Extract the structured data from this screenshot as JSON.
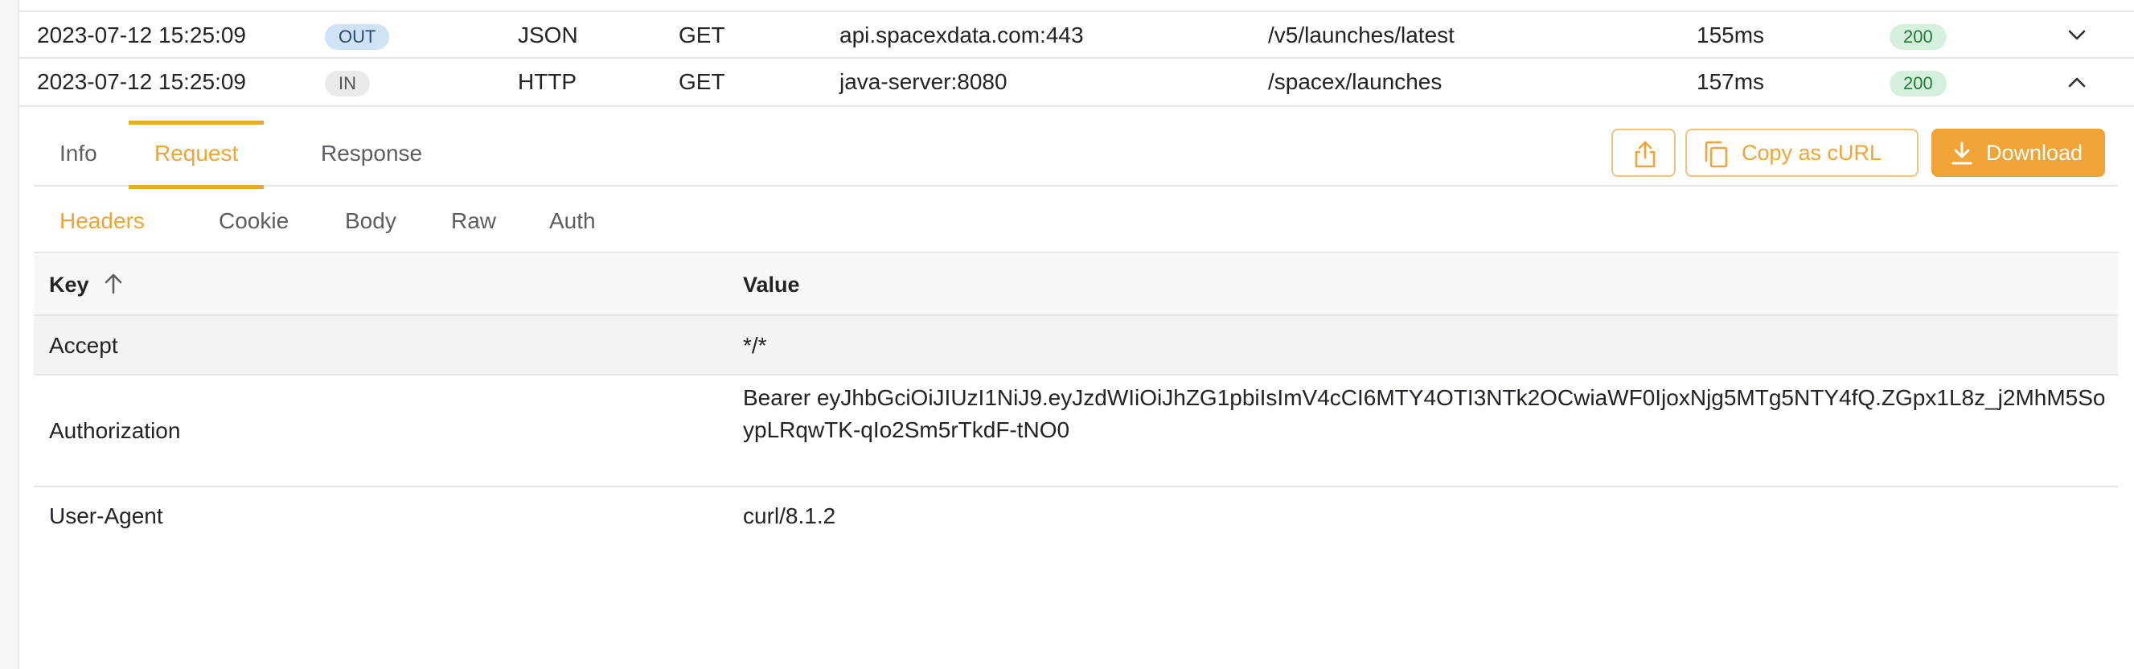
{
  "rows": [
    {
      "time": "2023-07-12 15:25:09",
      "direction": "OUT",
      "protocol": "JSON",
      "method": "GET",
      "host": "api.spacexdata.com:443",
      "path": "/v5/launches/latest",
      "duration": "155ms",
      "status": "200",
      "toggle_icon": "chevron-down-icon"
    },
    {
      "time": "2023-07-12 15:25:09",
      "direction": "IN",
      "protocol": "HTTP",
      "method": "GET",
      "host": "java-server:8080",
      "path": "/spacex/launches",
      "duration": "157ms",
      "status": "200",
      "toggle_icon": "chevron-up-icon"
    }
  ],
  "detail": {
    "tabs": [
      "Info",
      "Request",
      "Response"
    ],
    "active_tab": "Request",
    "actions": {
      "share_icon": "share-icon",
      "copy_label": "Copy as cURL",
      "download_label": "Download"
    },
    "subtabs": [
      "Headers",
      "Cookie",
      "Body",
      "Raw",
      "Auth"
    ],
    "active_subtab": "Headers",
    "table": {
      "key_header": "Key",
      "value_header": "Value",
      "sort_icon": "arrow-up-icon",
      "rows": [
        {
          "key": "Accept",
          "value": "*/*"
        },
        {
          "key": "Authorization",
          "value": "Bearer eyJhbGciOiJIUzI1NiJ9.eyJzdWIiOiJhZG1pbiIsImV4cCI6MTY4OTI3NTk2OCwiaWF0IjoxNjg5MTg5NTY4fQ.ZGpx1L8z_j2MhM5SoypLRqwTK-qIo2Sm5rTkdF-tNO0"
        },
        {
          "key": "User-Agent",
          "value": "curl/8.1.2"
        }
      ]
    }
  },
  "colors": {
    "accent": "#f0a336",
    "status_ok_bg": "#d5f1dd",
    "status_ok_fg": "#23783d",
    "out_badge_bg": "#cfe3f7",
    "in_badge_bg": "#e9eaec"
  }
}
